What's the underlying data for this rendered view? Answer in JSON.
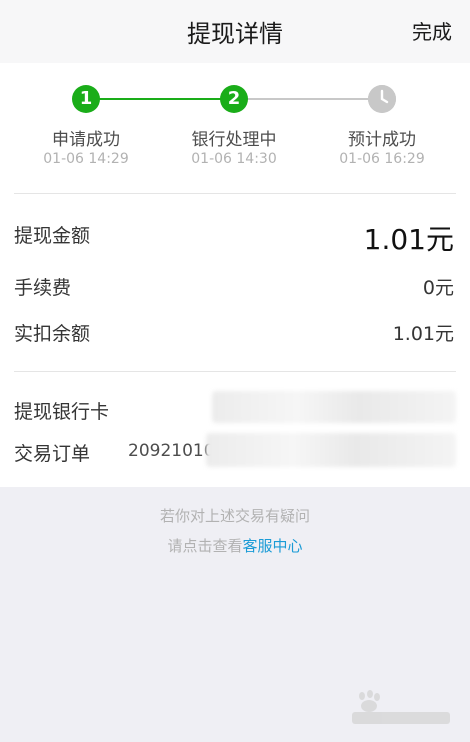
{
  "header": {
    "title": "提现详情",
    "done_label": "完成"
  },
  "progress": {
    "steps": [
      {
        "icon_text": "1",
        "label": "申请成功",
        "time": "01-06 14:29",
        "status": "done"
      },
      {
        "icon_text": "2",
        "label": "银行处理中",
        "time": "01-06 14:30",
        "status": "current"
      },
      {
        "icon": "clock-icon",
        "label": "预计成功",
        "time": "01-06 16:29",
        "status": "pending"
      }
    ]
  },
  "amounts": {
    "withdraw_label": "提现金额",
    "withdraw_value": "1.01元",
    "fee_label": "手续费",
    "fee_value": "0元",
    "deduct_label": "实扣余额",
    "deduct_value": "1.01元"
  },
  "details": {
    "bank_card_label": "提现银行卡",
    "order_label": "交易订单",
    "order_value_visible": "20921010"
  },
  "footer": {
    "line1": "若你对上述交易有疑问",
    "line2_prefix": "请点击查看",
    "line2_link": "客服中心"
  },
  "colors": {
    "accent_green": "#1aad19",
    "link_blue": "#1a9bd6",
    "pending_gray": "#c8c8c8"
  }
}
